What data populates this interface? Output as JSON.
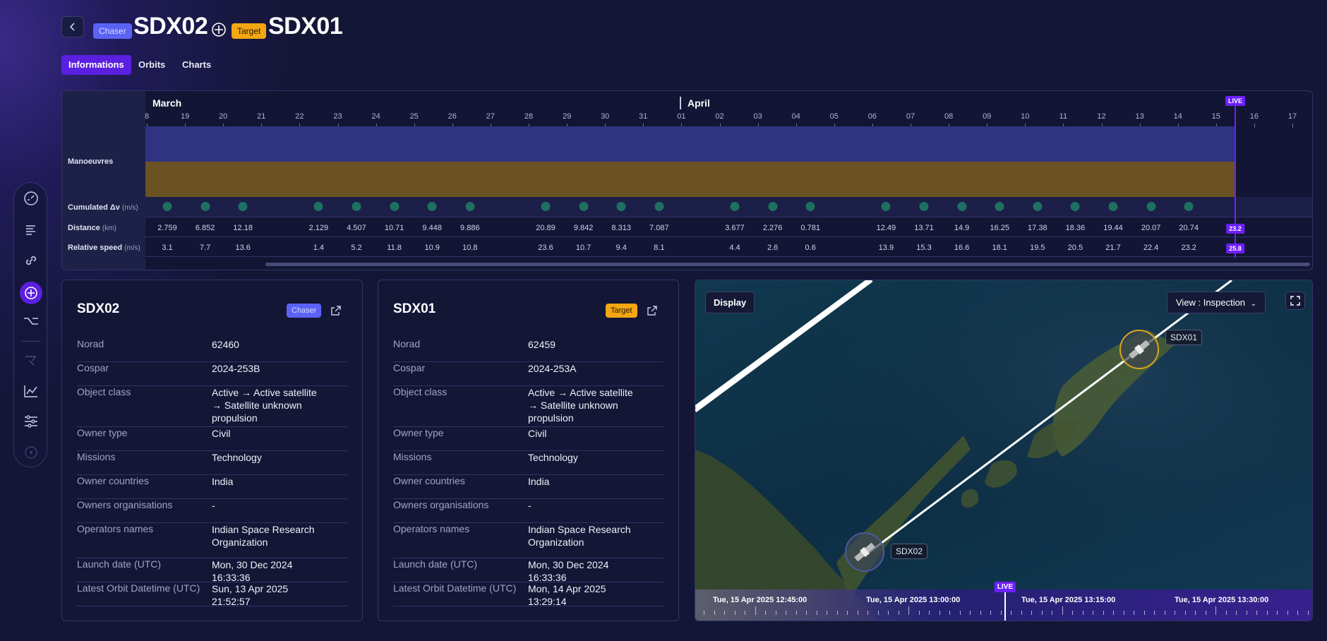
{
  "header": {
    "chaser_badge": "Chaser",
    "chaser_name": "SDX02",
    "target_badge": "Target",
    "target_name": "SDX01"
  },
  "tabs": [
    {
      "label": "Informations",
      "active": true
    },
    {
      "label": "Orbits",
      "active": false
    },
    {
      "label": "Charts",
      "active": false
    }
  ],
  "sidebar": {
    "icons": [
      "dashboard-icon",
      "list-icon",
      "link-icon",
      "target-icon",
      "branch-icon",
      "satellite-icon",
      "chart-line-icon",
      "sliders-icon",
      "circle-icon"
    ]
  },
  "timeline": {
    "months": [
      "March",
      "April"
    ],
    "days": [
      "8",
      "19",
      "20",
      "21",
      "22",
      "23",
      "24",
      "25",
      "26",
      "27",
      "28",
      "29",
      "30",
      "31",
      "01",
      "02",
      "03",
      "04",
      "05",
      "06",
      "07",
      "08",
      "09",
      "10",
      "11",
      "12",
      "13",
      "14",
      "15",
      "16",
      "17"
    ],
    "live_label": "LIVE",
    "rows": {
      "manoeuvres": "Manoeuvres",
      "cumulated_dv": "Cumulated Δv",
      "cumulated_dv_unit": "(m/s)",
      "distance": "Distance",
      "distance_unit": "(km)",
      "relative_speed": "Relative speed",
      "relative_speed_unit": "(m/s)"
    },
    "distance_values": [
      "2.759",
      "6.852",
      "12.18",
      "",
      "2.129",
      "4.507",
      "10.71",
      "9.448",
      "9.886",
      "",
      "20.89",
      "9.842",
      "8.313",
      "7.087",
      "",
      "3.677",
      "2.276",
      "0.781",
      "",
      "12.49",
      "13.71",
      "14.9",
      "16.25",
      "17.38",
      "18.36",
      "19.44",
      "20.07",
      "20.74"
    ],
    "speed_values": [
      "3.1",
      "7.7",
      "13.6",
      "",
      "1.4",
      "5.2",
      "11.8",
      "10.9",
      "10.8",
      "",
      "23.6",
      "10.7",
      "9.4",
      "8.1",
      "",
      "4.4",
      "2.6",
      "0.6",
      "",
      "13.9",
      "15.3",
      "16.6",
      "18.1",
      "19.5",
      "20.5",
      "21.7",
      "22.4",
      "23.2"
    ],
    "live_distance": "23.2",
    "live_speed": "25.8",
    "colors": {
      "chaser_band": "#2e3382",
      "target_band": "#6b5222",
      "dot": "#1e7060",
      "live": "#6d1fff"
    }
  },
  "cards": [
    {
      "name": "SDX02",
      "badge": "Chaser",
      "rows": [
        {
          "k": "Norad",
          "v": "62460"
        },
        {
          "k": "Cospar",
          "v": "2024-253B"
        },
        {
          "k": "Object class",
          "v": "Active → Active satellite → Satellite unknown propulsion"
        },
        {
          "k": "Owner type",
          "v": "Civil"
        },
        {
          "k": "Missions",
          "v": "Technology"
        },
        {
          "k": "Owner countries",
          "v": "India"
        },
        {
          "k": "Owners organisations",
          "v": "-"
        },
        {
          "k": "Operators names",
          "v": "Indian Space Research Organization"
        },
        {
          "k": "Launch date (UTC)",
          "v": "Mon, 30 Dec 2024 16:33:36"
        },
        {
          "k": "Latest Orbit Datetime (UTC)",
          "v": "Sun, 13 Apr 2025 21:52:57"
        }
      ]
    },
    {
      "name": "SDX01",
      "badge": "Target",
      "rows": [
        {
          "k": "Norad",
          "v": "62459"
        },
        {
          "k": "Cospar",
          "v": "2024-253A"
        },
        {
          "k": "Object class",
          "v": "Active → Active satellite → Satellite unknown propulsion"
        },
        {
          "k": "Owner type",
          "v": "Civil"
        },
        {
          "k": "Missions",
          "v": "Technology"
        },
        {
          "k": "Owner countries",
          "v": "India"
        },
        {
          "k": "Owners organisations",
          "v": "-"
        },
        {
          "k": "Operators names",
          "v": "Indian Space Research Organization"
        },
        {
          "k": "Launch date (UTC)",
          "v": "Mon, 30 Dec 2024 16:33:36"
        },
        {
          "k": "Latest Orbit Datetime (UTC)",
          "v": "Mon, 14 Apr 2025 13:29:14"
        }
      ]
    }
  ],
  "map": {
    "display_label": "Display",
    "view_label": "View : Inspection",
    "sat_target": "SDX01",
    "sat_chaser": "SDX02",
    "live_label": "LIVE",
    "timestamps": [
      "Tue, 15 Apr 2025 12:45:00",
      "Tue, 15 Apr 2025 13:00:00",
      "Tue, 15 Apr 2025 13:15:00",
      "Tue, 15 Apr 2025 13:30:00"
    ]
  }
}
